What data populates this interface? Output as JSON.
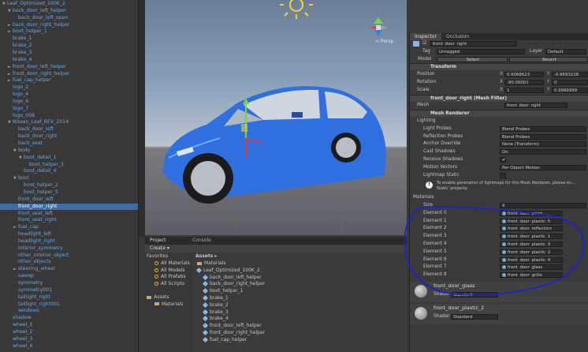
{
  "hierarchy": {
    "items": [
      {
        "label": "Leaf_Optimized_100K_2",
        "depth": 0,
        "arrow": "▼"
      },
      {
        "label": "back_door_left_helper",
        "depth": 1,
        "arrow": "▼"
      },
      {
        "label": "back_door_left_open",
        "depth": 2,
        "arrow": ""
      },
      {
        "label": "back_door_right_helper",
        "depth": 1,
        "arrow": "►"
      },
      {
        "label": "boot_helper_1",
        "depth": 1,
        "arrow": "►"
      },
      {
        "label": "brake_1",
        "depth": 1,
        "arrow": ""
      },
      {
        "label": "brake_2",
        "depth": 1,
        "arrow": ""
      },
      {
        "label": "brake_3",
        "depth": 1,
        "arrow": ""
      },
      {
        "label": "brake_4",
        "depth": 1,
        "arrow": ""
      },
      {
        "label": "front_door_left_helper",
        "depth": 1,
        "arrow": "►"
      },
      {
        "label": "front_door_right_helper",
        "depth": 1,
        "arrow": "►"
      },
      {
        "label": "fuel_cap_helper",
        "depth": 1,
        "arrow": "►"
      },
      {
        "label": "logo_2",
        "depth": 1,
        "arrow": ""
      },
      {
        "label": "logo_4",
        "depth": 1,
        "arrow": ""
      },
      {
        "label": "logo_6",
        "depth": 1,
        "arrow": ""
      },
      {
        "label": "logo_7",
        "depth": 1,
        "arrow": ""
      },
      {
        "label": "logo_008",
        "depth": 1,
        "arrow": ""
      },
      {
        "label": "Nissan_Leaf_BEV_2014",
        "depth": 1,
        "arrow": "▼"
      },
      {
        "label": "back_door_left",
        "depth": 2,
        "arrow": ""
      },
      {
        "label": "back_door_right",
        "depth": 2,
        "arrow": ""
      },
      {
        "label": "back_seat",
        "depth": 2,
        "arrow": ""
      },
      {
        "label": "body",
        "depth": 2,
        "arrow": "▼"
      },
      {
        "label": "boot_detail_1",
        "depth": 3,
        "arrow": "▼"
      },
      {
        "label": "boot_helper_3",
        "depth": 4,
        "arrow": ""
      },
      {
        "label": "boot_detail_4",
        "depth": 3,
        "arrow": ""
      },
      {
        "label": "boot",
        "depth": 2,
        "arrow": "▼"
      },
      {
        "label": "boot_helper_2",
        "depth": 3,
        "arrow": ""
      },
      {
        "label": "boot_helper_5",
        "depth": 3,
        "arrow": ""
      },
      {
        "label": "front_door_left",
        "depth": 2,
        "arrow": ""
      },
      {
        "label": "front_door_right",
        "depth": 2,
        "arrow": "",
        "selected": true
      },
      {
        "label": "front_seat_left",
        "depth": 2,
        "arrow": ""
      },
      {
        "label": "front_seat_right",
        "depth": 2,
        "arrow": ""
      },
      {
        "label": "fuel_cap",
        "depth": 2,
        "arrow": "►"
      },
      {
        "label": "headlight_left",
        "depth": 2,
        "arrow": ""
      },
      {
        "label": "headlight_right",
        "depth": 2,
        "arrow": ""
      },
      {
        "label": "interior_symmetry",
        "depth": 2,
        "arrow": ""
      },
      {
        "label": "other_interior_object",
        "depth": 2,
        "arrow": ""
      },
      {
        "label": "other_objects",
        "depth": 2,
        "arrow": ""
      },
      {
        "label": "steering_wheel",
        "depth": 2,
        "arrow": "►"
      },
      {
        "label": "sweep",
        "depth": 2,
        "arrow": ""
      },
      {
        "label": "symmetry",
        "depth": 2,
        "arrow": ""
      },
      {
        "label": "symmetry001",
        "depth": 2,
        "arrow": ""
      },
      {
        "label": "taillight_right",
        "depth": 2,
        "arrow": ""
      },
      {
        "label": "taillight_right001",
        "depth": 2,
        "arrow": ""
      },
      {
        "label": "windows",
        "depth": 2,
        "arrow": ""
      },
      {
        "label": "shadow",
        "depth": 1,
        "arrow": ""
      },
      {
        "label": "wheel_1",
        "depth": 1,
        "arrow": ""
      },
      {
        "label": "wheel_2",
        "depth": 1,
        "arrow": ""
      },
      {
        "label": "wheel_3",
        "depth": 1,
        "arrow": ""
      },
      {
        "label": "wheel_4",
        "depth": 1,
        "arrow": ""
      }
    ]
  },
  "scene": {
    "persp_label": "< Persp"
  },
  "inspector": {
    "tabs": [
      "Inspector",
      "Occlusion"
    ],
    "object_name": "front_door_right",
    "tag_label": "Tag",
    "tag_value": "Untagged",
    "layer_label": "Layer",
    "layer_value": "Default",
    "model_label": "Model",
    "select_label": "Select",
    "revert_label": "Revert",
    "transform": {
      "title": "Transform",
      "position": {
        "label": "Position",
        "x": "0.8068623",
        "y": "-0.6693228"
      },
      "rotation": {
        "label": "Rotation",
        "x": "-90.00001",
        "y": "0"
      },
      "scale": {
        "label": "Scale",
        "x": "1",
        "y": "0.9999999"
      }
    },
    "mesh_filter": {
      "title": "front_door_right (Mesh Filter)",
      "mesh_label": "Mesh",
      "mesh_value": "front_door_right"
    },
    "mesh_renderer": {
      "title": "Mesh Renderer",
      "lighting_label": "Lighting",
      "rows": [
        {
          "label": "Light Probes",
          "value": "Blend Probes"
        },
        {
          "label": "Reflection Probes",
          "value": "Blend Probes"
        },
        {
          "label": "Anchor Override",
          "value": "None (Transform)"
        },
        {
          "label": "Cast Shadows",
          "value": "On"
        },
        {
          "label": "Receive Shadows",
          "value": "✔"
        },
        {
          "label": "Motion Vectors",
          "value": "Per Object Motion"
        },
        {
          "label": "Lightmap Static",
          "value": ""
        }
      ],
      "info": "To enable generation of lightmaps for this Mesh Renderer, please en... Static' property."
    },
    "materials": {
      "title": "Materials",
      "size_label": "Size",
      "size_value": "9",
      "elements": [
        {
          "label": "Element 0",
          "value": "front_door_paint"
        },
        {
          "label": "Element 1",
          "value": "front_door_plastic_5"
        },
        {
          "label": "Element 2",
          "value": "front_door_reflection"
        },
        {
          "label": "Element 3",
          "value": "front_door_plastic_1"
        },
        {
          "label": "Element 4",
          "value": "front_door_plastic_3"
        },
        {
          "label": "Element 5",
          "value": "front_door_plastic_2"
        },
        {
          "label": "Element 6",
          "value": "front_door_plastic_4"
        },
        {
          "label": "Element 7",
          "value": "front_door_glass"
        },
        {
          "label": "Element 8",
          "value": "front_door_grille"
        }
      ]
    },
    "mat_blocks": [
      {
        "name": "front_door_glass",
        "shader_label": "Shader",
        "shader": "Standard"
      },
      {
        "name": "front_door_plastic_2",
        "shader_label": "Shader",
        "shader": "Standard"
      }
    ]
  },
  "project": {
    "tabs": [
      "Project",
      "Console"
    ],
    "create_label": "Create ▾",
    "favorites": {
      "title": "Favorites",
      "items": [
        "All Materials",
        "All Models",
        "All Prefabs",
        "All Scripts"
      ]
    },
    "assets_tree": {
      "title": "Assets",
      "items": [
        "Materials"
      ]
    },
    "breadcrumb": "Assets ▸",
    "list": [
      "Materials",
      "Leaf_Optimized_100K_2",
      "back_door_left_helper",
      "back_door_right_helper",
      "boot_helper_1",
      "brake_1",
      "brake_2",
      "brake_3",
      "brake_4",
      "front_door_left_helper",
      "front_door_right_helper",
      "fuel_cap_helper"
    ]
  },
  "colors": {
    "selection": "#3e6ca6",
    "car_body": "#2f6fe0",
    "annotation": "#1d23c7"
  }
}
